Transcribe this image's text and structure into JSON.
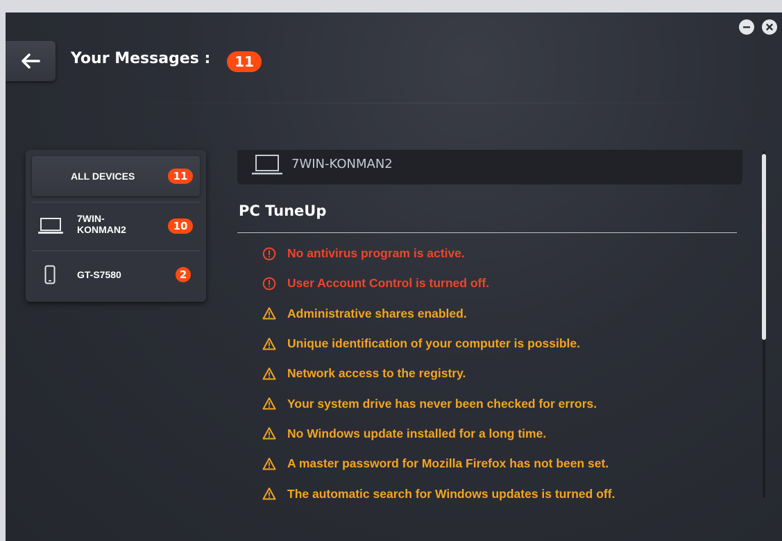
{
  "header": {
    "title": "Your Messages :",
    "count": "11"
  },
  "window_controls": {
    "minimize_icon": "minus-icon",
    "close_icon": "close-icon"
  },
  "devices": {
    "all": {
      "label": "ALL DEVICES",
      "count": "11"
    },
    "items": [
      {
        "label_line1": "7WIN-",
        "label_line2": "KONMAN2",
        "count": "10",
        "icon": "laptop-icon"
      },
      {
        "label": "GT-S7580",
        "count": "2",
        "icon": "phone-icon"
      }
    ]
  },
  "content": {
    "device_name": "7WIN-KONMAN2",
    "device_icon": "laptop-icon",
    "section_title": "PC TuneUp",
    "messages": [
      {
        "text": "No antivirus program is active.",
        "severity": "error"
      },
      {
        "text": "User Account Control is turned off.",
        "severity": "error"
      },
      {
        "text": "Administrative shares enabled.",
        "severity": "warning"
      },
      {
        "text": "Unique identification of your computer is possible.",
        "severity": "warning"
      },
      {
        "text": "Network access to the registry.",
        "severity": "warning"
      },
      {
        "text": "Your system drive has never been checked for errors.",
        "severity": "warning"
      },
      {
        "text": "No Windows update installed for a long time.",
        "severity": "warning"
      },
      {
        "text": "A master password for Mozilla Firefox has not been set.",
        "severity": "warning"
      },
      {
        "text": "The automatic search for Windows updates is turned off.",
        "severity": "warning"
      }
    ]
  },
  "colors": {
    "accent_badge": "#ff4b12",
    "error": "#f0452a",
    "warning": "#f4a521"
  }
}
